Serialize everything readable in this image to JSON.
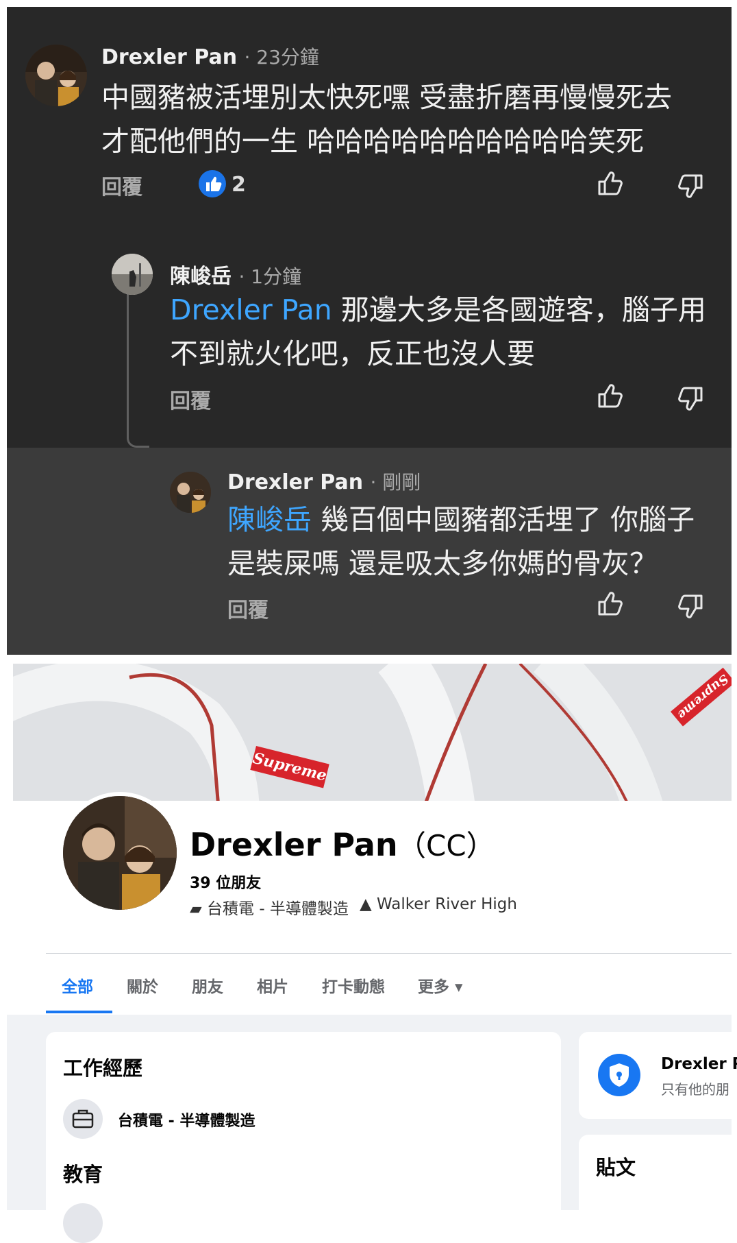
{
  "comments": [
    {
      "author": "Drexler Pan",
      "time": "· 23分鐘",
      "line1": "中國豬被活埋別太快死嘿 受盡折磨再慢慢死去",
      "line2": "才配他們的一生 哈哈哈哈哈哈哈哈哈哈笑死",
      "reply_label": "回覆",
      "like_count": "2"
    },
    {
      "author": "陳峻岳",
      "time": "· 1分鐘",
      "mention": "Drexler Pan",
      "line1": " 那邊大多是各國遊客，腦子用",
      "line2": "不到就火化吧，反正也沒人要",
      "reply_label": "回覆"
    },
    {
      "author": "Drexler Pan",
      "time": "· 剛剛",
      "mention": "陳峻岳",
      "line1": " 幾百個中國豬都活埋了 你腦子",
      "line2": "是裝屎嗎 還是吸太多你媽的骨灰？",
      "reply_label": "回覆"
    }
  ],
  "cover": {
    "brand_text": "Supreme"
  },
  "profile": {
    "name": "Drexler Pan",
    "nickname": "（CC）",
    "friends": "39 位朋友",
    "work": "台積電 - 半導體製造",
    "school": "Walker River High"
  },
  "tabs": [
    "全部",
    "關於",
    "朋友",
    "相片",
    "打卡動態",
    "更多 ▾"
  ],
  "intro": {
    "work_title": "工作經歷",
    "work_item": "台積電 - 半導體製造",
    "edu_title": "教育"
  },
  "privacy_card": {
    "name": "Drexler P",
    "sub": "只有他的朋"
  },
  "posts_card": {
    "title": "貼文"
  },
  "colors": {
    "dark_bg": "#282828",
    "highlight_bg": "#3b3b3b",
    "mention": "#3ea6ff",
    "fb_blue": "#1877f2"
  }
}
